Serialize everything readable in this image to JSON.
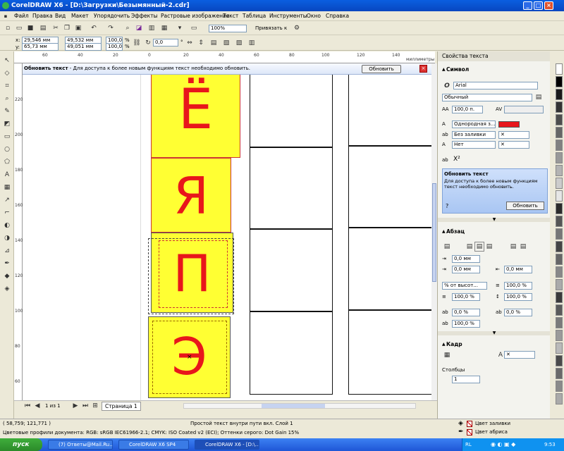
{
  "window": {
    "title": "CorelDRAW X6 - [D:\\Загрузки\\Безымянный-2.cdr]"
  },
  "menu": [
    "Файл",
    "Правка",
    "Вид",
    "Макет",
    "Упорядочить",
    "Эффекты",
    "Растровые изображения",
    "Текст",
    "Таблица",
    "Инструменты",
    "Окно",
    "Справка"
  ],
  "toolbar": {
    "zoom": "100%",
    "snap_label": "Привязать к"
  },
  "propbar": {
    "x_label": "x:",
    "x": "29,546 мм",
    "y_label": "y:",
    "y": "65,73 мм",
    "width": "49,532 мм",
    "height": "49,051 мм",
    "scale_x": "100,0",
    "scale_y": "100,0",
    "scale_unit": "%",
    "angle": "0,0",
    "angle_unit": "°"
  },
  "ruler": {
    "units": "миллиметры",
    "h_ticks": [
      "60",
      "40",
      "20",
      "0",
      "20",
      "40",
      "60",
      "80",
      "100",
      "120",
      "140"
    ],
    "v_ticks": [
      "220",
      "200",
      "180",
      "160",
      "140",
      "120",
      "100",
      "80",
      "60"
    ]
  },
  "notice": {
    "title": "Обновить текст",
    "text": "- Для доступа к более новым функциям текст необходимо обновить.",
    "button": "Обновить"
  },
  "cards": [
    {
      "letter": "Ё"
    },
    {
      "letter": "Я"
    },
    {
      "letter": "П"
    },
    {
      "letter": "Э"
    }
  ],
  "page_nav": {
    "counter": "1 из 1",
    "page_tab": "Страница 1"
  },
  "panel": {
    "title": "Свойства текста",
    "symbol": {
      "header": "Символ",
      "font": "Arial",
      "style": "Обычный",
      "size": "100,0 п.",
      "fill_type": "Однородная з...",
      "bg_fill": "Без заливки",
      "outline": "Нет",
      "text_color": "#E8161B"
    },
    "update": {
      "title": "Обновить текст",
      "text": "Для доступа к более новым функциям текст необходимо обновить.",
      "button": "Обновить"
    },
    "paragraph": {
      "header": "Абзац",
      "indent1": "0,0 мм",
      "indent2": "0,0 мм",
      "indent3": "0,0 мм",
      "line_spacing": "% от высот...",
      "line_value": "100,0 %",
      "before": "100,0 %",
      "after": "100,0 %",
      "char_spacing": "0,0 %",
      "word_spacing": "100,0 %",
      "lang": "0,0 %"
    },
    "frame": {
      "header": "Кадр",
      "columns_label": "Столбцы",
      "columns": "1"
    }
  },
  "status": {
    "coords": "( 58,759; 121,771 )",
    "object": "Простой текст внутри пути вкл. Слой 1",
    "profiles": "Цветовые профили документа: RGB: sRGB IEC61966-2.1; CMYK: ISO Coated v2 (ECI); Оттенки серого: Dot Gain 15%",
    "fill_label": "Цвет заливки",
    "outline_label": "Цвет абриса"
  },
  "taskbar": {
    "start": "пуск",
    "tasks": [
      "(7) Ответы@Mail.Ru...",
      "CorelDRAW X6 SP4",
      "CorelDRAW X6 - [D:\\..."
    ],
    "lang": "RL",
    "time": "9:53"
  },
  "colors": {
    "card_fill": "#FFFF33",
    "letter": "#E8161B",
    "title_bg": "#0A5FE0"
  }
}
